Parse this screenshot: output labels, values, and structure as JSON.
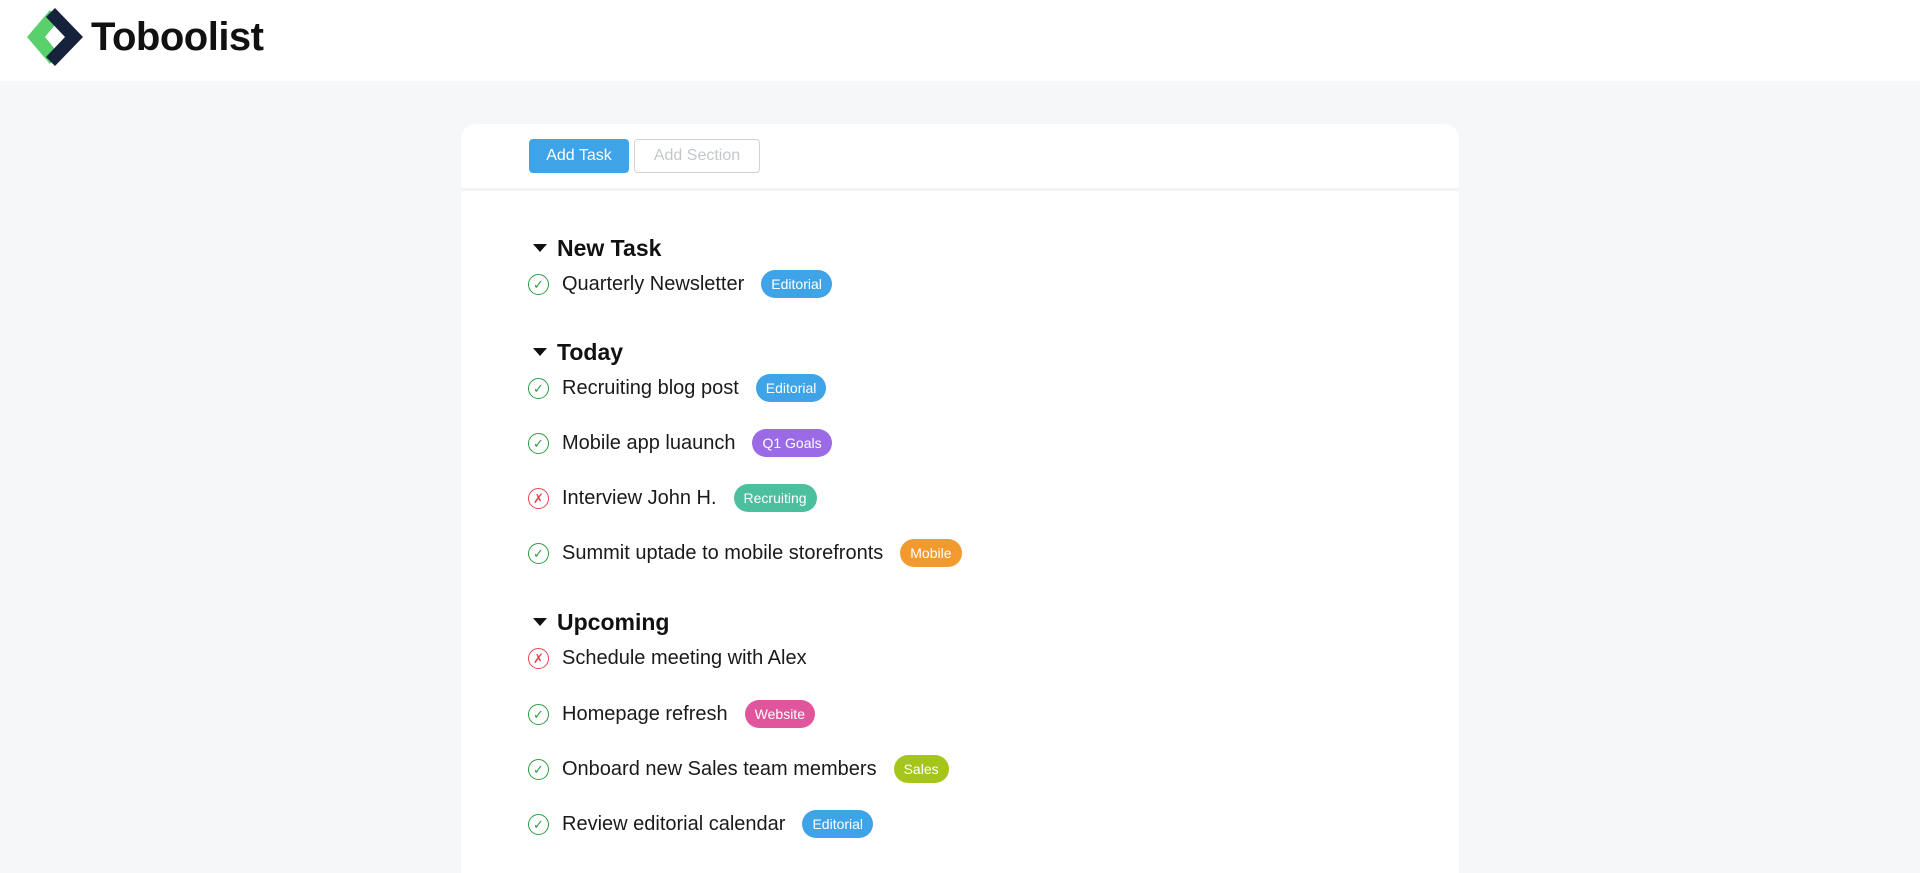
{
  "app": {
    "name": "Toboolist",
    "logo_icon": "toboolist-logo-icon"
  },
  "toolbar": {
    "add_task_label": "Add Task",
    "add_section_label": "Add Section"
  },
  "colors": {
    "primary": "#3fa3e8",
    "done": "#2e9a43",
    "fail": "#e5484d",
    "tag_editorial": "#3fa3e8",
    "tag_q1_goals": "#9b6be6",
    "tag_recruiting": "#4cbf9f",
    "tag_mobile": "#f29a2e",
    "tag_website": "#e0559b",
    "tag_sales": "#a4c61a"
  },
  "sections": [
    {
      "title": "New Task",
      "tasks": [
        {
          "title": "Quarterly Newsletter",
          "status": "done",
          "status_icon": "checkmark-icon",
          "tag": "Editorial",
          "tag_color": "#3fa3e8"
        }
      ]
    },
    {
      "title": "Today",
      "tasks": [
        {
          "title": "Recruiting blog post",
          "status": "done",
          "status_icon": "checkmark-icon",
          "tag": "Editorial",
          "tag_color": "#3fa3e8"
        },
        {
          "title": "Mobile app luaunch",
          "status": "done",
          "status_icon": "checkmark-icon",
          "tag": "Q1 Goals",
          "tag_color": "#9b6be6"
        },
        {
          "title": "Interview John H.",
          "status": "fail",
          "status_icon": "x-icon",
          "tag": "Recruiting",
          "tag_color": "#4cbf9f"
        },
        {
          "title": "Summit uptade to mobile storefronts",
          "status": "done",
          "status_icon": "checkmark-icon",
          "tag": "Mobile",
          "tag_color": "#f29a2e"
        }
      ]
    },
    {
      "title": "Upcoming",
      "tasks": [
        {
          "title": "Schedule meeting with Alex",
          "status": "fail",
          "status_icon": "x-icon",
          "tag": "",
          "tag_color": ""
        },
        {
          "title": "Homepage refresh",
          "status": "done",
          "status_icon": "checkmark-icon",
          "tag": "Website",
          "tag_color": "#e0559b"
        },
        {
          "title": "Onboard new Sales team members",
          "status": "done",
          "status_icon": "checkmark-icon",
          "tag": "Sales",
          "tag_color": "#a4c61a"
        },
        {
          "title": "Review editorial calendar",
          "status": "done",
          "status_icon": "checkmark-icon",
          "tag": "Editorial",
          "tag_color": "#3fa3e8"
        }
      ]
    }
  ]
}
